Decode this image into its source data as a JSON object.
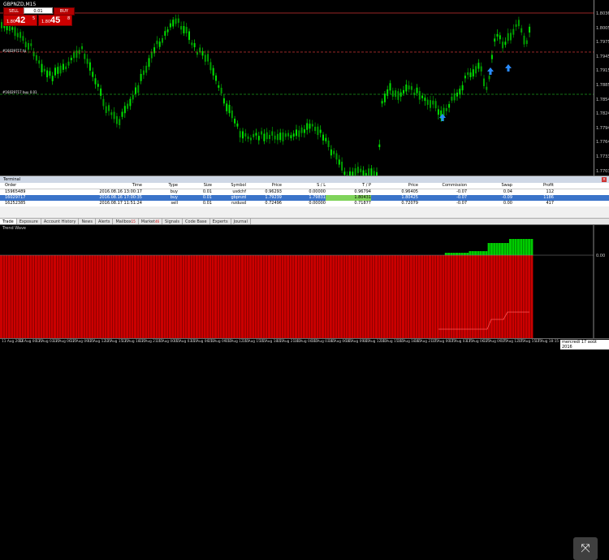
{
  "chart": {
    "symbol": "GBPNZD,M15",
    "sell_label": "SELL",
    "buy_label": "BUY",
    "lot": "0.01",
    "sell_price_small": "1.80",
    "sell_price_big": "42",
    "sell_price_sup": "5",
    "buy_price_small": "1.80",
    "buy_price_big": "45",
    "buy_price_sup": "8",
    "line_label_tp": "#16029717 tp",
    "line_label_buy": "#16029717 buy 0.01",
    "price_ticks": [
      "1.80360",
      "1.80050",
      "1.79755",
      "1.79450",
      "1.79150",
      "1.78850",
      "1.78545",
      "1.78245",
      "1.77940",
      "1.77640",
      "1.77335",
      "1.77035"
    ],
    "colors": {
      "bull": "#00e000",
      "bear": "#00a000",
      "arrow": "#2a8cff",
      "sl_line": "#c33",
      "buy_line": "#1a9a1a",
      "tp_line": "#c33"
    }
  },
  "terminal": {
    "title": "Terminal",
    "columns": [
      "Order",
      "Time",
      "Type",
      "Size",
      "Symbol",
      "Price",
      "S / L",
      "T / P",
      "Price",
      "Commission",
      "Swap",
      "Profit"
    ],
    "rows": [
      [
        "15965489",
        "2016.08.16 13:00:17",
        "buy",
        "0.01",
        "usdchf",
        "0.96293",
        "0.00000",
        "0.96794",
        "0.96405",
        "-0.07",
        "0.04",
        "112"
      ],
      [
        "16029717",
        "2016.08.16 17:00:35",
        "buy",
        "0.01",
        "gbpnzd",
        "1.79239",
        "1.79831",
        "1.80431",
        "1.80425",
        "-0.07",
        "-0.09",
        "1186"
      ],
      [
        "16252385",
        "2016.08.17 11:51:24",
        "sell",
        "0.01",
        "nzdusd",
        "0.72496",
        "0.00000",
        "0.71877",
        "0.72079",
        "-0.07",
        "0.00",
        "417"
      ]
    ],
    "selected_row": 1,
    "tabs": [
      {
        "label": "Trade",
        "badge": ""
      },
      {
        "label": "Exposure",
        "badge": ""
      },
      {
        "label": "Account History",
        "badge": ""
      },
      {
        "label": "News",
        "badge": ""
      },
      {
        "label": "Alerts",
        "badge": ""
      },
      {
        "label": "Mailbox",
        "badge": "15"
      },
      {
        "label": "Market",
        "badge": "46"
      },
      {
        "label": "Signals",
        "badge": ""
      },
      {
        "label": "Code Base",
        "badge": ""
      },
      {
        "label": "Experts",
        "badge": ""
      },
      {
        "label": "Journal",
        "badge": ""
      }
    ]
  },
  "indicator": {
    "title": "Trend Wave",
    "level_label": "0.00",
    "colors": {
      "up": "#00cc00",
      "down": "#cc0000"
    }
  },
  "time_axis": {
    "labels": [
      "11 Aug 2016",
      "12 Aug 00:15",
      "12 Aug 03:15",
      "12 Aug 06:15",
      "12 Aug 09:15",
      "12 Aug 12:15",
      "12 Aug 15:15",
      "12 Aug 18:15",
      "12 Aug 21:15",
      "15 Aug 00:15",
      "15 Aug 03:15",
      "15 Aug 06:15",
      "15 Aug 09:15",
      "15 Aug 12:15",
      "15 Aug 15:15",
      "15 Aug 18:15",
      "15 Aug 21:15",
      "16 Aug 00:15",
      "16 Aug 03:15",
      "16 Aug 06:15",
      "16 Aug 09:15",
      "16 Aug 12:15",
      "16 Aug 15:15",
      "16 Aug 18:15",
      "16 Aug 21:15",
      "17 Aug 00:15",
      "17 Aug 03:15",
      "17 Aug 06:15",
      "17 Aug 09:15",
      "17 Aug 12:15",
      "17 Aug 15:15",
      "17 Aug 18:15"
    ],
    "date_tip": "mercredi 17 août 2016"
  }
}
